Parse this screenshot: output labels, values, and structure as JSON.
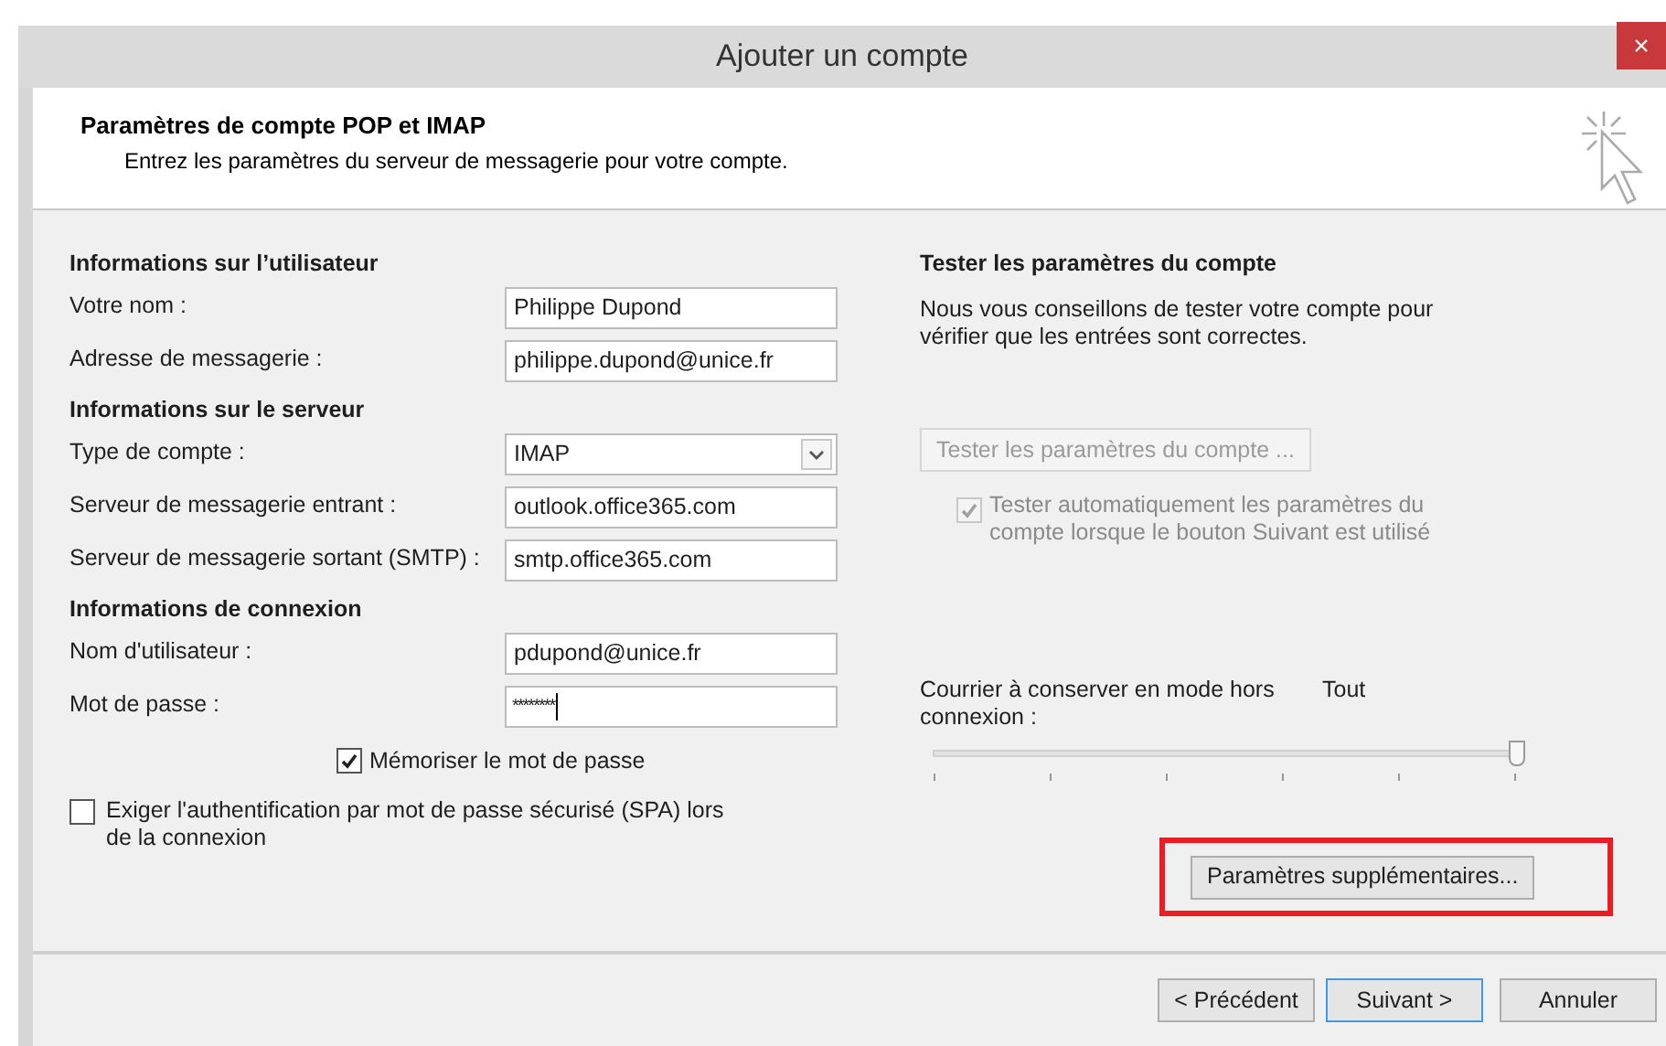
{
  "window": {
    "title": "Ajouter un compte",
    "close": "×"
  },
  "header": {
    "title": "Paramètres de compte POP et IMAP",
    "subtitle": "Entrez les paramètres du serveur de messagerie pour votre compte."
  },
  "left_sections": [
    {
      "heading": "Informations sur l’utilisateur",
      "fields": [
        {
          "kind": "text",
          "label": "Votre nom :",
          "value": "Philippe Dupond"
        },
        {
          "kind": "text",
          "label": "Adresse de messagerie :",
          "value": "philippe.dupond@unice.fr"
        }
      ]
    },
    {
      "heading": "Informations sur le serveur",
      "fields": [
        {
          "kind": "select",
          "label": "Type de compte :",
          "value": "IMAP"
        },
        {
          "kind": "text",
          "label": "Serveur de messagerie entrant :",
          "value": "outlook.office365.com"
        },
        {
          "kind": "text",
          "label": "Serveur de messagerie sortant (SMTP) :",
          "value": "smtp.office365.com"
        }
      ]
    },
    {
      "heading": "Informations de connexion",
      "fields": [
        {
          "kind": "text",
          "label": "Nom d'utilisateur :",
          "value": "pdupond@unice.fr"
        },
        {
          "kind": "password",
          "label": "Mot de passe :",
          "value": "********"
        }
      ]
    }
  ],
  "remember_password": {
    "label": "Mémoriser le mot de passe",
    "checked": true
  },
  "require_spa": {
    "label": "Exiger l'authentification par mot de passe sécurisé (SPA) lors de la connexion",
    "checked": false
  },
  "test_section": {
    "heading": "Tester les paramètres du compte",
    "description": "Nous vous conseillons de tester votre compte pour vérifier que les entrées sont correctes.",
    "button": {
      "label": "Tester les paramètres du compte ...",
      "disabled": true
    },
    "auto_test": {
      "label": "Tester automatiquement les paramètres du compte lorsque le bouton Suivant est utilisé",
      "checked": true,
      "disabled": true
    }
  },
  "offline_mail": {
    "label": "Courrier à conserver en mode hors connexion :",
    "reading": "Tout",
    "level": 1
  },
  "more_settings": {
    "label": "Paramètres supplémentaires...",
    "highlighted": true
  },
  "footer_buttons": [
    {
      "label": "< Précédent",
      "default": false
    },
    {
      "label": "Suivant >",
      "default": true
    },
    {
      "label": "Annuler",
      "default": false
    }
  ]
}
